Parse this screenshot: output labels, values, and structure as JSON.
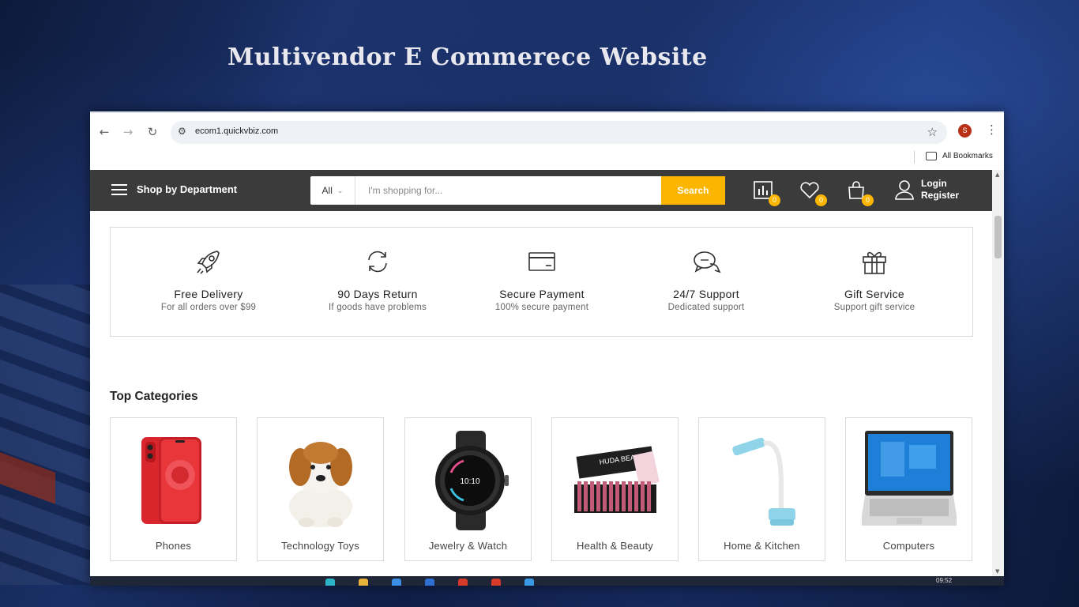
{
  "slide": {
    "title": "Multivendor E Commerece Website"
  },
  "browser": {
    "url": "ecom1.quickvbiz.com",
    "profile_initial": "S",
    "bookmarks_label": "All Bookmarks"
  },
  "header": {
    "shop_by_department": "Shop by Department",
    "search": {
      "category": "All",
      "placeholder": "I'm shopping for...",
      "button": "Search"
    },
    "compare_count": "0",
    "wishlist_count": "0",
    "cart_count": "0",
    "login": "Login",
    "register": "Register"
  },
  "features": [
    {
      "icon": "rocket-icon",
      "title": "Free Delivery",
      "subtitle": "For all orders over $99"
    },
    {
      "icon": "return-icon",
      "title": "90 Days Return",
      "subtitle": "If goods have problems"
    },
    {
      "icon": "credit-card-icon",
      "title": "Secure Payment",
      "subtitle": "100% secure payment"
    },
    {
      "icon": "chat-icon",
      "title": "24/7 Support",
      "subtitle": "Dedicated support"
    },
    {
      "icon": "gift-icon",
      "title": "Gift Service",
      "subtitle": "Support gift service"
    }
  ],
  "top_categories": {
    "heading": "Top Categories",
    "items": [
      {
        "label": "Phones",
        "image": "phone-image"
      },
      {
        "label": "Technology Toys",
        "image": "plush-dog-image"
      },
      {
        "label": "Jewelry & Watch",
        "image": "smartwatch-image"
      },
      {
        "label": "Health & Beauty",
        "image": "lipstick-set-image"
      },
      {
        "label": "Home & Kitchen",
        "image": "desk-lamp-image"
      },
      {
        "label": "Computers",
        "image": "laptop-image"
      }
    ],
    "image_brand_text": "HUDA BEAUTY",
    "watch_time": "10:10"
  },
  "taskbar": {
    "time": "09:52"
  },
  "colors": {
    "accent": "#fcb600",
    "header_bg": "#3b3b3b"
  }
}
